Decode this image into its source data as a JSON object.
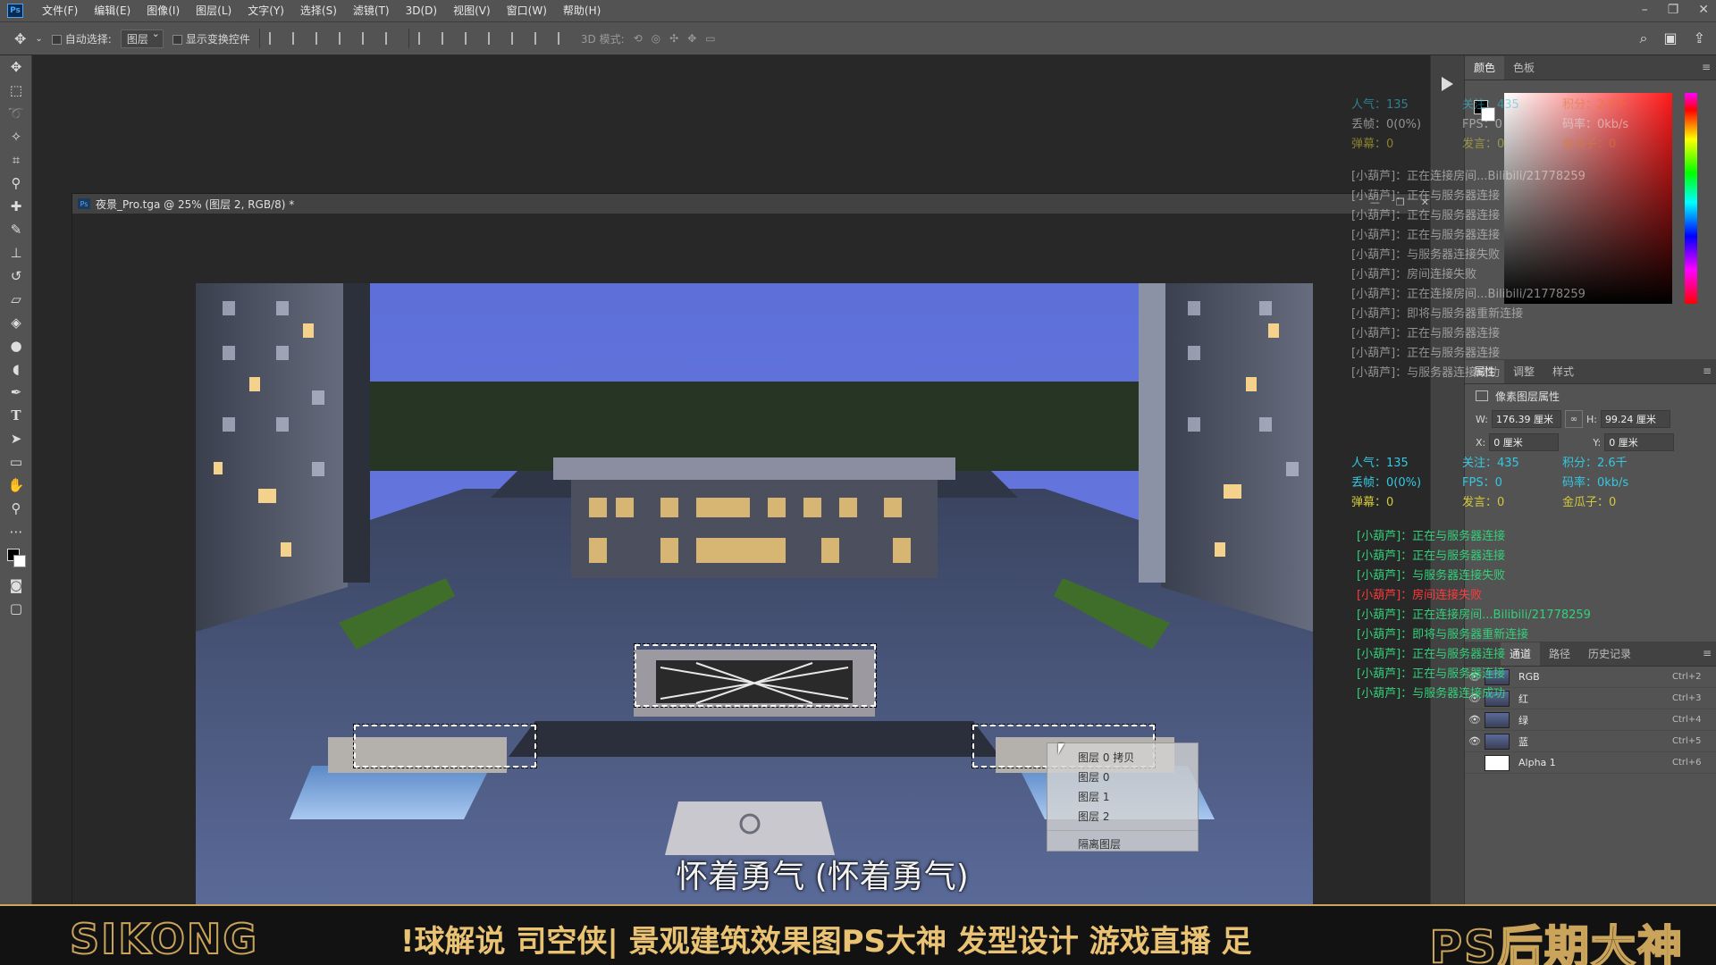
{
  "menubar": {
    "logo": "Ps",
    "items": [
      "文件(F)",
      "编辑(E)",
      "图像(I)",
      "图层(L)",
      "文字(Y)",
      "选择(S)",
      "滤镜(T)",
      "3D(D)",
      "视图(V)",
      "窗口(W)",
      "帮助(H)"
    ]
  },
  "options": {
    "auto_select_label": "自动选择:",
    "auto_select_value": "图层",
    "show_transform_label": "显示变换控件",
    "mode_3d_label": "3D 模式:"
  },
  "document": {
    "tab_title": "夜景_Pro.tga @ 25% (图层 2, RGB/8) *"
  },
  "context_menu": {
    "items": [
      "图层 0 拷贝",
      "图层 0",
      "图层 1",
      "图层 2"
    ],
    "isolate": "隔离图层"
  },
  "subtitle": "怀着勇气 (怀着勇气)",
  "stats": {
    "popularity": "人气：135",
    "dropped": "丢帧：0(0%)",
    "danmaku": "弹幕：0",
    "follows": "关注：435",
    "score": "积分：2.6千",
    "fps": "FPS：0",
    "bitrate": "码率：0kb/s",
    "messages": "发言：0",
    "melon": "金瓜子：0"
  },
  "log": [
    {
      "text": "[小葫芦]：正在与服务器连接",
      "error": false
    },
    {
      "text": "[小葫芦]：正在与服务器连接",
      "error": false
    },
    {
      "text": "[小葫芦]：与服务器连接失败",
      "error": false
    },
    {
      "text": "[小葫芦]：房间连接失败",
      "error": true
    },
    {
      "text": "[小葫芦]：正在连接房间...Bilibili/21778259",
      "error": false
    },
    {
      "text": "[小葫芦]：即将与服务器重新连接",
      "error": false
    },
    {
      "text": "[小葫芦]：正在与服务器连接",
      "error": false
    },
    {
      "text": "[小葫芦]：正在与服务器连接",
      "error": false
    },
    {
      "text": "[小葫芦]：与服务器连接成功",
      "error": false
    }
  ],
  "ghost_log": [
    "[小葫芦]：正在连接房间...Bilibili/21778259",
    "[小葫芦]：正在与服务器连接",
    "[小葫芦]：正在与服务器连接",
    "[小葫芦]：正在与服务器连接",
    "[小葫芦]：与服务器连接失败",
    "[小葫芦]：房间连接失败",
    "[小葫芦]：正在连接房间...Bilibili/21778259",
    "[小葫芦]：即将与服务器重新连接",
    "[小葫芦]：正在与服务器连接",
    "[小葫芦]：正在与服务器连接",
    "[小葫芦]：与服务器连接成功"
  ],
  "color_panel": {
    "tabs": [
      "颜色",
      "色板"
    ]
  },
  "properties": {
    "tabs": [
      "属性",
      "调整",
      "样式"
    ],
    "title": "像素图层属性",
    "w_label": "W:",
    "w_value": "176.39 厘米",
    "h_label": "H:",
    "h_value": "99.24 厘米",
    "x_label": "X:",
    "x_value": "0 厘米",
    "y_label": "Y:",
    "y_value": "0 厘米"
  },
  "channels": {
    "tabs": [
      "通道",
      "路径",
      "历史记录"
    ],
    "rows": [
      {
        "name": "RGB",
        "key": "Ctrl+2"
      },
      {
        "name": "红",
        "key": "Ctrl+3"
      },
      {
        "name": "绿",
        "key": "Ctrl+4"
      },
      {
        "name": "蓝",
        "key": "Ctrl+5"
      },
      {
        "name": "Alpha 1",
        "key": "Ctrl+6"
      }
    ]
  },
  "banner": {
    "left": "SIKONG",
    "marquee": "!球解说  司空侠|  景观建筑效果图PS大神  发型设计  游戏直播  足",
    "right": "PS后期大神"
  },
  "colors": {
    "accent_gold": "#caa55a",
    "log_green": "#33d07a",
    "error_red": "#ff3a3a"
  }
}
